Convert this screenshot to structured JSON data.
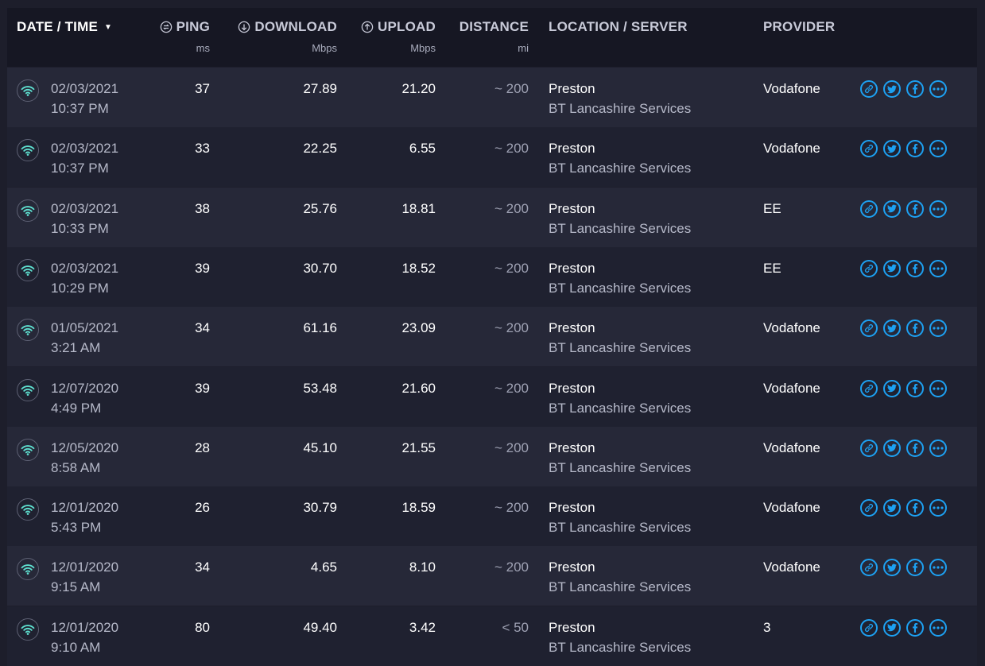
{
  "header": {
    "date_time": "DATE / TIME",
    "ping": "PING",
    "ping_unit": "ms",
    "download": "DOWNLOAD",
    "download_unit": "Mbps",
    "upload": "UPLOAD",
    "upload_unit": "Mbps",
    "distance": "DISTANCE",
    "distance_unit": "mi",
    "location": "LOCATION / SERVER",
    "provider": "PROVIDER"
  },
  "colors": {
    "accent": "#1da1f2",
    "wifi": "#5ee0d0"
  },
  "rows": [
    {
      "date": "02/03/2021",
      "time": "10:37 PM",
      "ping": "37",
      "download": "27.89",
      "upload": "21.20",
      "distance": "~ 200",
      "city": "Preston",
      "server": "BT Lancashire Services",
      "provider": "Vodafone"
    },
    {
      "date": "02/03/2021",
      "time": "10:37 PM",
      "ping": "33",
      "download": "22.25",
      "upload": "6.55",
      "distance": "~ 200",
      "city": "Preston",
      "server": "BT Lancashire Services",
      "provider": "Vodafone"
    },
    {
      "date": "02/03/2021",
      "time": "10:33 PM",
      "ping": "38",
      "download": "25.76",
      "upload": "18.81",
      "distance": "~ 200",
      "city": "Preston",
      "server": "BT Lancashire Services",
      "provider": "EE"
    },
    {
      "date": "02/03/2021",
      "time": "10:29 PM",
      "ping": "39",
      "download": "30.70",
      "upload": "18.52",
      "distance": "~ 200",
      "city": "Preston",
      "server": "BT Lancashire Services",
      "provider": "EE"
    },
    {
      "date": "01/05/2021",
      "time": "3:21 AM",
      "ping": "34",
      "download": "61.16",
      "upload": "23.09",
      "distance": "~ 200",
      "city": "Preston",
      "server": "BT Lancashire Services",
      "provider": "Vodafone"
    },
    {
      "date": "12/07/2020",
      "time": "4:49 PM",
      "ping": "39",
      "download": "53.48",
      "upload": "21.60",
      "distance": "~ 200",
      "city": "Preston",
      "server": "BT Lancashire Services",
      "provider": "Vodafone"
    },
    {
      "date": "12/05/2020",
      "time": "8:58 AM",
      "ping": "28",
      "download": "45.10",
      "upload": "21.55",
      "distance": "~ 200",
      "city": "Preston",
      "server": "BT Lancashire Services",
      "provider": "Vodafone"
    },
    {
      "date": "12/01/2020",
      "time": "5:43 PM",
      "ping": "26",
      "download": "30.79",
      "upload": "18.59",
      "distance": "~ 200",
      "city": "Preston",
      "server": "BT Lancashire Services",
      "provider": "Vodafone"
    },
    {
      "date": "12/01/2020",
      "time": "9:15 AM",
      "ping": "34",
      "download": "4.65",
      "upload": "8.10",
      "distance": "~ 200",
      "city": "Preston",
      "server": "BT Lancashire Services",
      "provider": "Vodafone"
    },
    {
      "date": "12/01/2020",
      "time": "9:10 AM",
      "ping": "80",
      "download": "49.40",
      "upload": "3.42",
      "distance": "< 50",
      "city": "Preston",
      "server": "BT Lancashire Services",
      "provider": "3"
    }
  ]
}
